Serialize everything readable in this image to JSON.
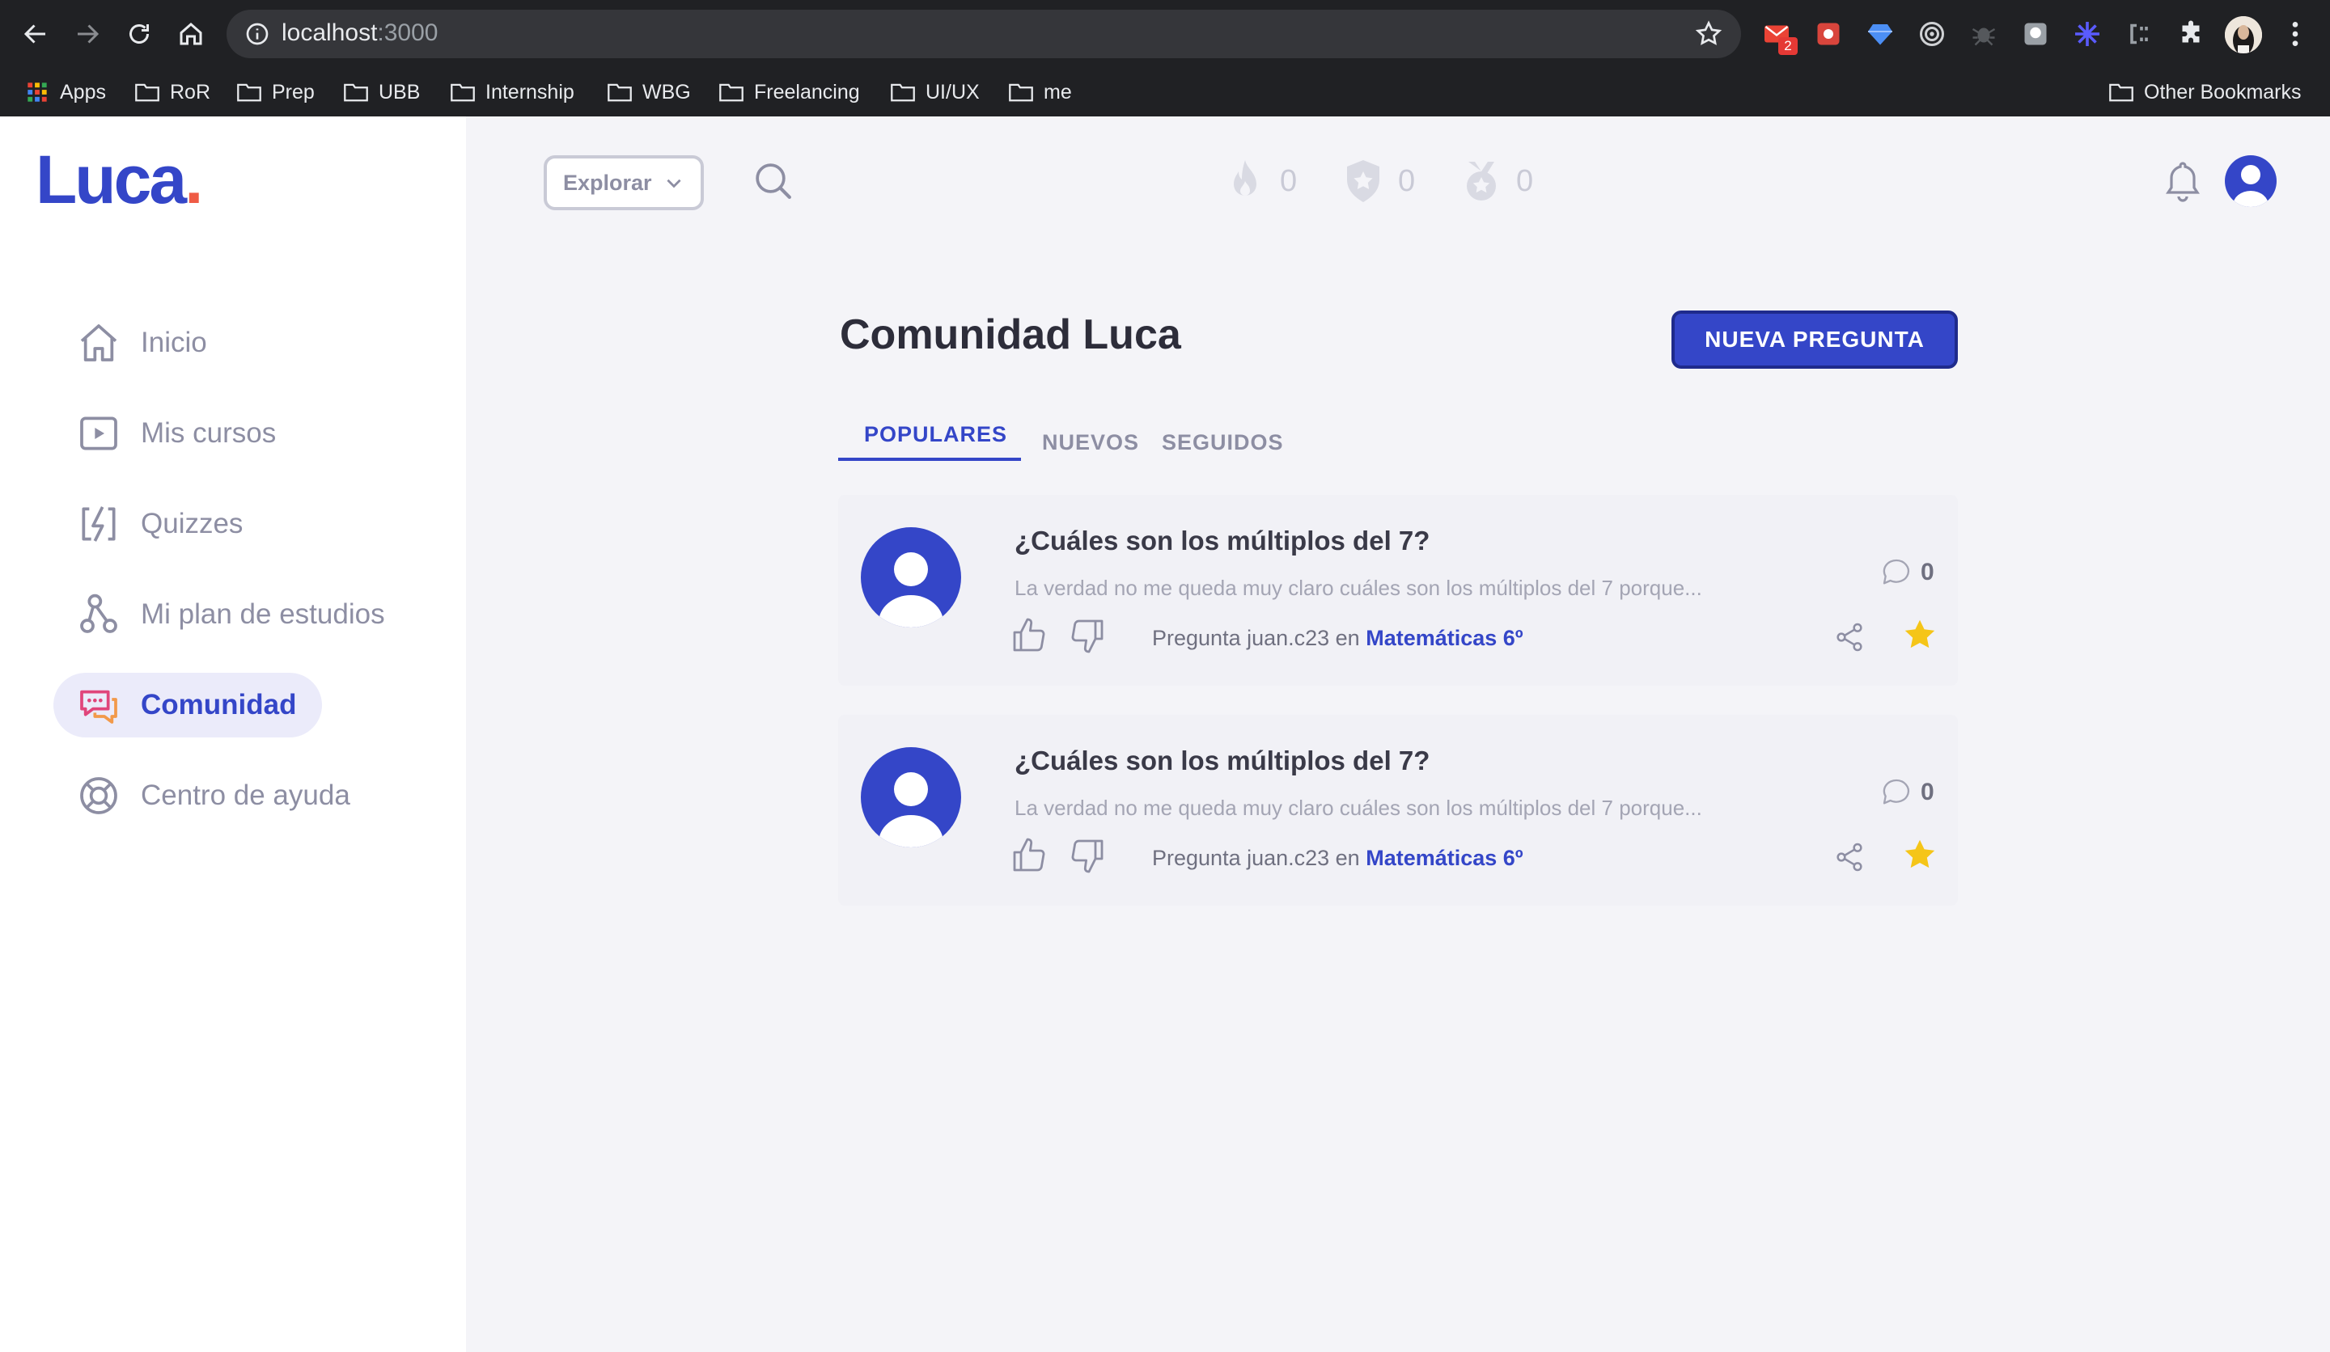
{
  "browser": {
    "url_host": "localhost",
    "url_port": ":3000",
    "extension_badge": "2",
    "bookmarks": [
      "Apps",
      "RoR",
      "Prep",
      "UBB",
      "Internship",
      "WBG",
      "Freelancing",
      "UI/UX",
      "me"
    ],
    "other_bookmarks": "Other Bookmarks"
  },
  "app": {
    "logo_text": "Luca",
    "logo_dot": ".",
    "brand_color": "#3446c8",
    "accent_color": "#ef5b45"
  },
  "sidebar": {
    "items": [
      {
        "label": "Inicio",
        "icon": "home-icon"
      },
      {
        "label": "Mis cursos",
        "icon": "play-icon"
      },
      {
        "label": "Quizzes",
        "icon": "lightning-icon"
      },
      {
        "label": "Mi plan de estudios",
        "icon": "study-plan-icon"
      },
      {
        "label": "Comunidad",
        "icon": "chat-icon",
        "active": true
      },
      {
        "label": "Centro de ayuda",
        "icon": "lifebuoy-icon"
      }
    ]
  },
  "topbar": {
    "explore_label": "Explorar",
    "stats": [
      {
        "icon": "flame-icon",
        "value": "0"
      },
      {
        "icon": "shield-star-icon",
        "value": "0"
      },
      {
        "icon": "medal-icon",
        "value": "0"
      }
    ]
  },
  "main": {
    "title": "Comunidad Luca",
    "new_question_label": "NUEVA PREGUNTA",
    "tabs": [
      {
        "label": "POPULARES",
        "active": true
      },
      {
        "label": "NUEVOS"
      },
      {
        "label": "SEGUIDOS"
      }
    ],
    "questions": [
      {
        "title": "¿Cuáles son los múltiplos del 7?",
        "excerpt": "La verdad no me queda muy claro cuáles son los múltiplos del 7 porque...",
        "meta_prefix": "Pregunta juan.c23 en ",
        "course": "Matemáticas 6º",
        "comments": "0",
        "favorite": true
      },
      {
        "title": "¿Cuáles son los múltiplos del 7?",
        "excerpt": "La verdad no me queda muy claro cuáles son los múltiplos del 7 porque...",
        "meta_prefix": "Pregunta juan.c23 en ",
        "course": "Matemáticas 6º",
        "comments": "0",
        "favorite": true
      }
    ]
  }
}
